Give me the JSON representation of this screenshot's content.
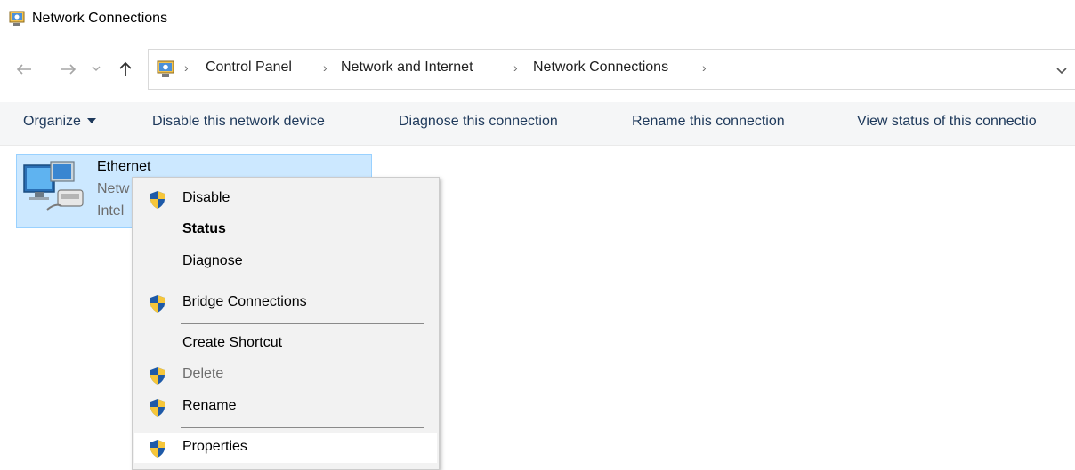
{
  "window": {
    "title": "Network Connections"
  },
  "address_bar": {
    "breadcrumbs": [
      "Control Panel",
      "Network and Internet",
      "Network Connections"
    ]
  },
  "toolbar": {
    "organize": "Organize",
    "disable_device": "Disable this network device",
    "diagnose": "Diagnose this connection",
    "rename": "Rename this connection",
    "view_status": "View status of this connectio"
  },
  "connection": {
    "name": "Ethernet",
    "status_partial": "Netw",
    "device_partial": "Intel"
  },
  "context_menu": {
    "items": [
      {
        "label": "Disable",
        "icon": "shield-icon"
      },
      {
        "label": "Status",
        "icon": ""
      },
      {
        "label": "Diagnose",
        "icon": ""
      },
      {
        "label": "Bridge Connections",
        "icon": "shield-icon"
      },
      {
        "label": "Create Shortcut",
        "icon": ""
      },
      {
        "label": "Delete",
        "icon": "shield-icon"
      },
      {
        "label": "Rename",
        "icon": "shield-icon"
      },
      {
        "label": "Properties",
        "icon": "shield-icon"
      }
    ]
  },
  "colors": {
    "selection_fill": "#cce8ff",
    "selection_border": "#99d1ff",
    "toolbar_bg": "#f5f6f7",
    "toolbar_text": "#1e395b",
    "menu_bg": "#f2f2f2"
  }
}
